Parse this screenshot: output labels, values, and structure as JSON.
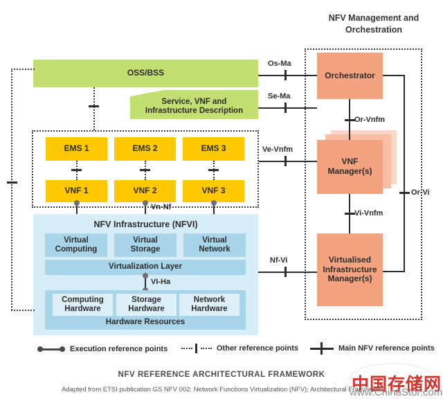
{
  "diagram": {
    "mano_title": "NFV Management and\nOrchestration",
    "mano_title_line1": "NFV Management and",
    "mano_title_line2": "Orchestration",
    "oss_bss": "OSS/BSS",
    "description_box_line1": "Service, VNF and",
    "description_box_line2": "Infrastructure Description",
    "ems": [
      "EMS 1",
      "EMS 2",
      "EMS 3"
    ],
    "vnf": [
      "VNF 1",
      "VNF 2",
      "VNF 3"
    ],
    "nfvi_title": "NFV Infrastructure (NFVI)",
    "virtual_layer": [
      {
        "line1": "Virtual",
        "line2": "Computing"
      },
      {
        "line1": "Virtual",
        "line2": "Storage"
      },
      {
        "line1": "Virtual",
        "line2": "Network"
      }
    ],
    "virtualization_layer": "Virtualization Layer",
    "hardware": [
      {
        "line1": "Computing",
        "line2": "Hardware"
      },
      {
        "line1": "Storage",
        "line2": "Hardware"
      },
      {
        "line1": "Network",
        "line2": "Hardware"
      }
    ],
    "hardware_resources": "Hardware Resources",
    "mano": {
      "orchestrator": "Orchestrator",
      "vnf_manager_line1": "VNF",
      "vnf_manager_line2": "Manager(s)",
      "vim_line1": "Virtualised",
      "vim_line2": "Infrastructure",
      "vim_line3": "Manager(s)"
    },
    "reference_points": {
      "os_ma": "Os-Ma",
      "se_ma": "Se-Ma",
      "ve_vnfm": "Ve-Vnfm",
      "nf_vi": "Nf-Vi",
      "or_vnfm": "Or-Vnfm",
      "vi_vnfm": "Vi-Vnfm",
      "or_vi": "Or-Vi",
      "vn_nf": "Vn-Nf",
      "vi_ha": "VI-Ha"
    },
    "colors": {
      "green": "#c3df72",
      "yellow": "#ffc800",
      "orange": "#f3a380",
      "nfvi_background": "#d7edf8",
      "blue_mid": "#a8d5e9",
      "blue_light": "#ddf0f9",
      "line": "#2b2b2b",
      "watermark_red": "#d0342c"
    }
  },
  "legend": [
    {
      "icon": "execution-reference-icon",
      "label": "Execution reference points"
    },
    {
      "icon": "other-reference-icon",
      "label": "Other reference points"
    },
    {
      "icon": "main-reference-icon",
      "label": "Main NFV reference points"
    }
  ],
  "footer": {
    "title": "NFV REFERENCE ARCHITECTURAL FRAMEWORK",
    "source": "Adapted from ETSI publication GS NFV 002: Network Functions Virtualization (NFV); Architectural Framework"
  },
  "watermark": {
    "cn": "中国存储网",
    "en": "www.ChinaStor.com"
  }
}
